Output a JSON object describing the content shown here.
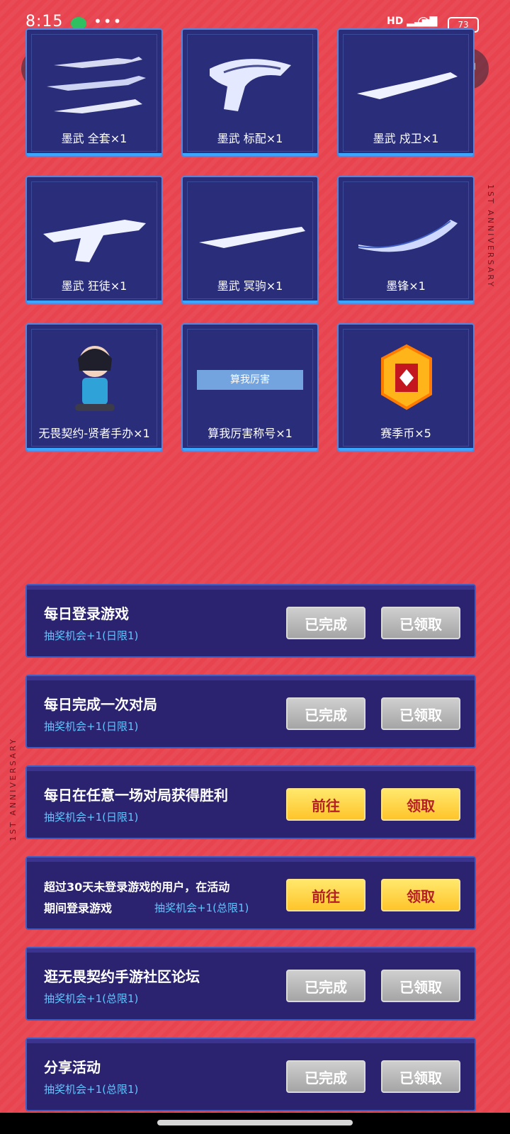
{
  "status_bar": {
    "time": "8:15",
    "icons": [
      "wechat-icon",
      "more-dots-icon",
      "signal-icon",
      "wifi-icon",
      "battery-icon"
    ],
    "signal_text": "HD",
    "battery_text": "73"
  },
  "nav": {
    "back_icon": "‹",
    "share_icon": "↗"
  },
  "side_text": {
    "right": "1ST ANNIVERSARY",
    "left": "1ST ANNIVERSARY"
  },
  "rewards": [
    {
      "label": "墨武 全套×1"
    },
    {
      "label": "墨武 标配×1"
    },
    {
      "label": "墨武 戍卫×1"
    },
    {
      "label": "墨武 狂徒×1"
    },
    {
      "label": "墨武 冥驹×1"
    },
    {
      "label": "墨锋×1"
    },
    {
      "label": "无畏契约-贤者手办×1"
    },
    {
      "label": "算我厉害称号×1",
      "banner": "算我厉害"
    },
    {
      "label": "赛季币×5"
    }
  ],
  "tasks": [
    {
      "title": "每日登录游戏",
      "subtitle": "抽奖机会+1(日限1)",
      "left_btn": "已完成",
      "right_btn": "已领取",
      "left_state": "done",
      "right_state": "done"
    },
    {
      "title": "每日完成一次对局",
      "subtitle": "抽奖机会+1(日限1)",
      "left_btn": "已完成",
      "right_btn": "已领取",
      "left_state": "done",
      "right_state": "done"
    },
    {
      "title": "每日在任意一场对局获得胜利",
      "subtitle": "抽奖机会+1(日限1)",
      "left_btn": "前往",
      "right_btn": "领取",
      "left_state": "go",
      "right_state": "go"
    },
    {
      "title_line1": "超过30天未登录游戏的用户，在活动",
      "title_line2": "期间登录游戏",
      "subtitle": "抽奖机会+1(总限1)",
      "left_btn": "前往",
      "right_btn": "领取",
      "left_state": "go",
      "right_state": "go"
    },
    {
      "title": "逛无畏契约手游社区论坛",
      "subtitle": "抽奖机会+1(总限1)",
      "left_btn": "已完成",
      "right_btn": "已领取",
      "left_state": "done",
      "right_state": "done"
    },
    {
      "title": "分享活动",
      "subtitle": "抽奖机会+1(总限1)",
      "left_btn": "已完成",
      "right_btn": "已领取",
      "left_state": "done",
      "right_state": "done"
    }
  ],
  "colors": {
    "background": "#e8444f",
    "card_bg": "#2a2e7a",
    "task_bg": "#2b2370",
    "accent_blue": "#5ec6ff",
    "go_button": "#ffd23a",
    "done_button": "#b8b8b8"
  }
}
